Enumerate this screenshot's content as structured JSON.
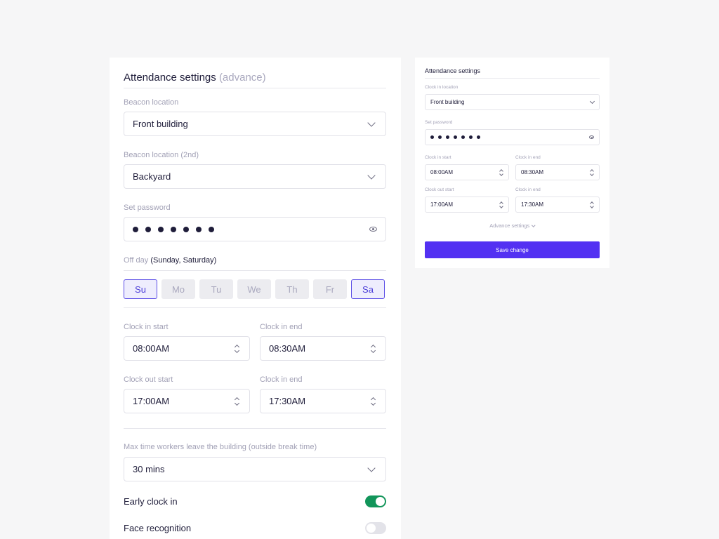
{
  "advanced": {
    "title": "Attendance settings",
    "title_suffix": "(advance)",
    "beacon": {
      "label": "Beacon location",
      "value": "Front building"
    },
    "beacon2": {
      "label": "Beacon location (2nd)",
      "value": "Backyard"
    },
    "password": {
      "label": "Set password",
      "dot_count": 7
    },
    "offday": {
      "label": "Off day",
      "summary": "(Sunday, Saturday)",
      "days": [
        {
          "label": "Su",
          "selected": true
        },
        {
          "label": "Mo",
          "selected": false
        },
        {
          "label": "Tu",
          "selected": false
        },
        {
          "label": "We",
          "selected": false
        },
        {
          "label": "Th",
          "selected": false
        },
        {
          "label": "Fr",
          "selected": false
        },
        {
          "label": "Sa",
          "selected": true
        }
      ]
    },
    "clock_in_start": {
      "label": "Clock in start",
      "value": "08:00AM"
    },
    "clock_in_end": {
      "label": "Clock in end",
      "value": "08:30AM"
    },
    "clock_out_start": {
      "label": "Clock out start",
      "value": "17:00AM"
    },
    "clock_out_end": {
      "label": "Clock in end",
      "value": "17:30AM"
    },
    "max_time": {
      "label": "Max time workers leave the building (outside break time)",
      "value": "30 mins"
    },
    "early_clock_in": {
      "label": "Early clock in",
      "on": true
    },
    "face_recognition": {
      "label": "Face recognition",
      "on": false
    }
  },
  "simple": {
    "title": "Attendance settings",
    "clock_location": {
      "label": "Clock in location",
      "value": "Front building"
    },
    "password": {
      "label": "Set password",
      "dot_count": 7
    },
    "clock_in_start": {
      "label": "Clock in start",
      "value": "08:00AM"
    },
    "clock_in_end": {
      "label": "Clock in end",
      "value": "08:30AM"
    },
    "clock_out_start": {
      "label": "Clock out start",
      "value": "17:00AM"
    },
    "clock_out_end": {
      "label": "Clock in end",
      "value": "17:30AM"
    },
    "advance_link": "Advance settings",
    "save_button": "Save change"
  },
  "colors": {
    "accent": "#5331f2",
    "selected_day_border": "#5a4ce6",
    "toggle_on": "#12955a"
  }
}
